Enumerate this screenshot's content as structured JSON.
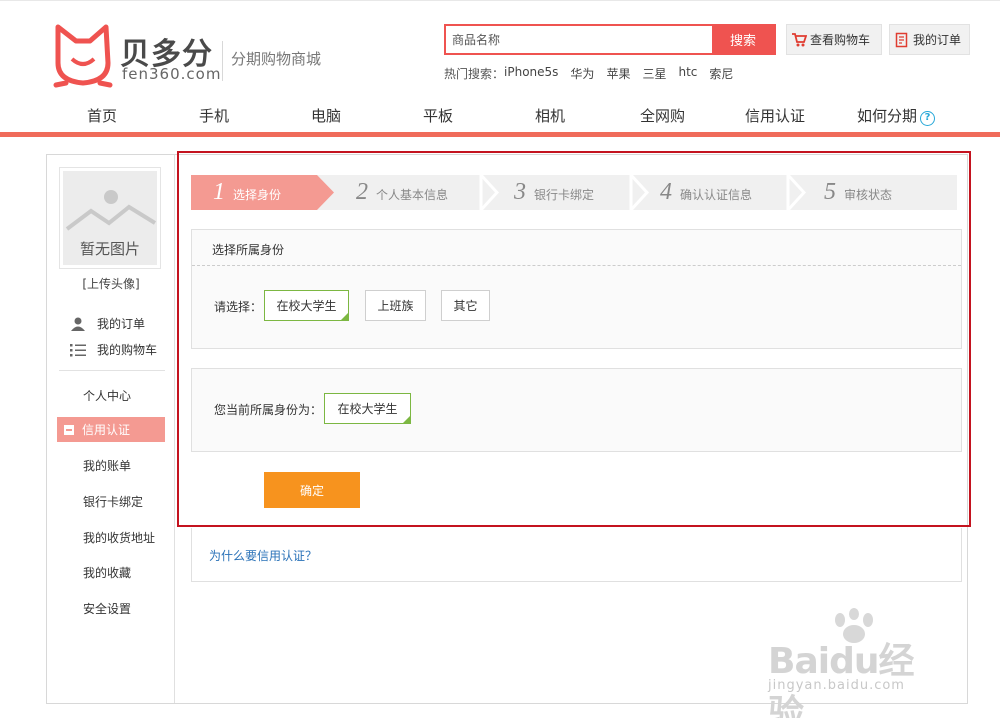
{
  "brand": {
    "name": "贝多分",
    "domain": "fen360.com",
    "slogan": "分期购物商城",
    "accent": "#ef5350"
  },
  "search": {
    "placeholder": "商品名称",
    "button": "搜索",
    "hot_label": "热门搜索：",
    "hot_items": [
      "iPhone5s",
      "华为",
      "苹果",
      "三星",
      "htc",
      "索尼"
    ]
  },
  "top_buttons": {
    "cart": "查看购物车",
    "orders": "我的订单"
  },
  "nav": [
    "首页",
    "手机",
    "电脑",
    "平板",
    "相机",
    "全网购",
    "信用认证",
    "如何分期"
  ],
  "sidebar": {
    "avatar_text": "暂无图片",
    "upload": "[上传头像]",
    "links": [
      "我的订单",
      "我的购物车"
    ],
    "menu": [
      "个人中心",
      "信用认证",
      "我的账单",
      "银行卡绑定",
      "我的收货地址",
      "我的收藏",
      "安全设置"
    ],
    "active_color": "#f49a92"
  },
  "steps": [
    {
      "num": "1",
      "label": "选择身份"
    },
    {
      "num": "2",
      "label": "个人基本信息"
    },
    {
      "num": "3",
      "label": "银行卡绑定"
    },
    {
      "num": "4",
      "label": "确认认证信息"
    },
    {
      "num": "5",
      "label": "审核状态"
    }
  ],
  "identity": {
    "title": "选择所属身份",
    "choose_label": "请选择：",
    "options": [
      "在校大学生",
      "上班族",
      "其它"
    ],
    "selected": "在校大学生",
    "current_label": "您当前所属身份为：",
    "current_value": "在校大学生",
    "confirm": "确定",
    "why_link": "为什么要信用认证？"
  },
  "watermark": {
    "brand": "Baidu经验",
    "sub": "jingyan.baidu.com"
  }
}
